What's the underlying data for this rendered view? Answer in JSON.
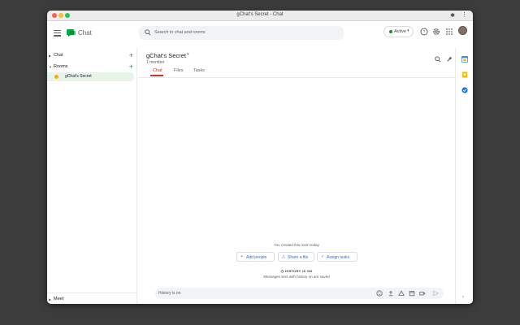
{
  "window": {
    "title": "gChat's Secret - Chat"
  },
  "header": {
    "app_name": "Chat",
    "search_placeholder": "Search in chat and rooms",
    "status_label": "Active",
    "status_color": "#1e8e3e",
    "icons": [
      "menu-icon",
      "help-icon",
      "gear-icon",
      "apps-grid-icon",
      "avatar"
    ]
  },
  "sidebar": {
    "chat_label": "Chat",
    "rooms_label": "Rooms",
    "rooms": [
      {
        "label": "gChat's Secret"
      }
    ],
    "meet_label": "Meet"
  },
  "room": {
    "title": "gChat's Secret",
    "members": "1 member",
    "tabs": [
      "Chat",
      "Files",
      "Tasks"
    ],
    "active_tab": "Chat"
  },
  "feed": {
    "created_notice": "You created this room today",
    "actions": [
      "Add people",
      "Share a file",
      "Assign tasks"
    ],
    "history_heading": "HISTORY IS ON",
    "history_sub": "Messages sent with history on are saved"
  },
  "composer": {
    "value": "History is on"
  },
  "accent": "#1a73e8"
}
